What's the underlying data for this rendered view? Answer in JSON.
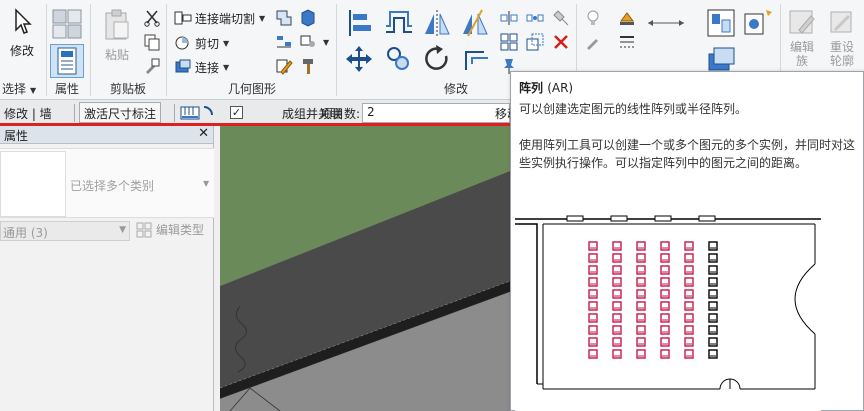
{
  "ribbon": {
    "modify_label": "修改",
    "select_label": "选择",
    "properties_label": "属性",
    "clipboard": {
      "paste_label": "粘贴",
      "panel_label": "剪贴板"
    },
    "geometry": {
      "join_cut_label": "连接端切割",
      "cut_label": "剪切",
      "join_label": "连接",
      "panel_label": "几何图形"
    },
    "modify_panel_label": "修改",
    "edit_family_label_top": "编辑",
    "edit_family_label_bottom": "族",
    "reset_label_top": "重设",
    "reset_label_bottom": "轮廓"
  },
  "options_bar": {
    "context": "修改 | 墙",
    "activate_dim_label": "激活尺寸标注",
    "group_associate_label": "成组并关联",
    "group_associate_checked": true,
    "item_count_label": "项目数:",
    "item_count_value": "2",
    "move_to_label": "移动"
  },
  "properties": {
    "title": "属性",
    "type_selector_text": "已选择多个类别",
    "filter_value": "通用 (3)",
    "edit_type_label": "编辑类型"
  },
  "tooltip": {
    "title": "阵列",
    "shortcut": "(AR)",
    "description": "可以创建选定图元的线性阵列或半径阵列。",
    "detail": "使用阵列工具可以创建一个或多个图元的多个实例，并同时对这些实例执行操作。可以指定阵列中的图元之间的距离。"
  },
  "colors": {
    "accent_red": "#e02020",
    "array_red": "#c8174a",
    "wall_green": "#6b8a5a"
  }
}
